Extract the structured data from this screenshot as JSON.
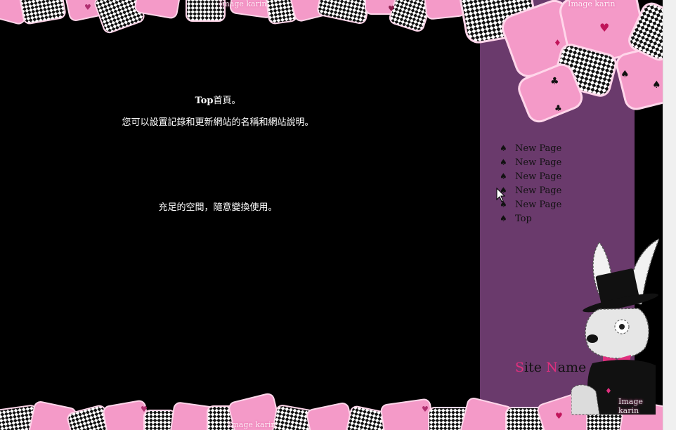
{
  "main": {
    "title_bold": "Top",
    "title_rest": "首頁。",
    "description": "您可以設置記錄和更新網站的名稱和網站說明。",
    "free_space": "充足的空間，隨意變換使用。"
  },
  "nav": {
    "bullet": "♠",
    "items": [
      {
        "label": "New Page"
      },
      {
        "label": "New Page"
      },
      {
        "label": "New Page"
      },
      {
        "label": "New Page"
      },
      {
        "label": "New Page"
      },
      {
        "label": "Top"
      }
    ]
  },
  "site_name": {
    "first_initial": "S",
    "first_rest": "ite ",
    "second_initial": "N",
    "second_rest": "ame"
  },
  "credits": {
    "top_center": "Image karin",
    "top_right": "Image karin",
    "bottom_center": "Image karin",
    "bottom_right": "Image karin"
  },
  "colors": {
    "background": "#000000",
    "sidebar": "#6a3a6c",
    "card_pink": "#f49ac8",
    "accent": "#e0307e"
  },
  "icons": {
    "nav_bullet": "spade-icon",
    "mascot": "rabbit-illustration",
    "cursor": "mouse-cursor-icon"
  }
}
